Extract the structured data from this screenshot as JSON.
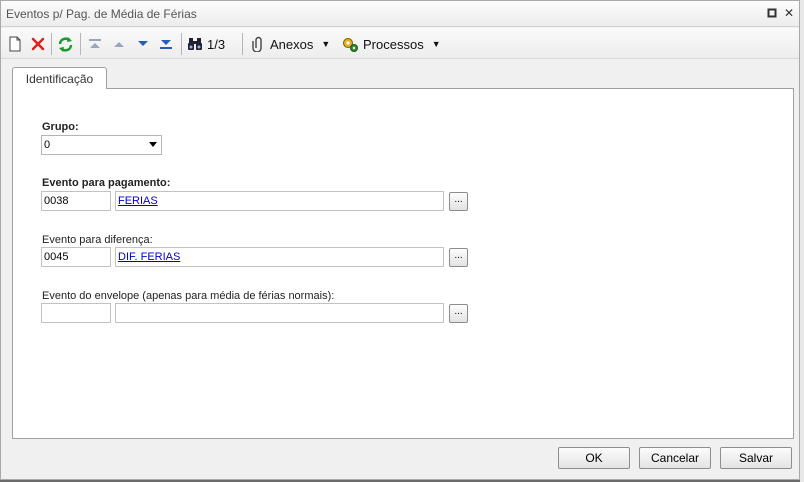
{
  "window": {
    "title": "Eventos p/ Pag. de Média de Férias",
    "restore_symbol": "▫",
    "close_symbol": "✕"
  },
  "toolbar": {
    "icons": [
      "new-icon",
      "delete-icon",
      "refresh-icon",
      "first-record-icon",
      "previous-record-icon",
      "next-record-icon",
      "last-record-icon",
      "search-icon"
    ],
    "record_position": "1/3",
    "attachments_label": "Anexos",
    "processes_label": "Processos"
  },
  "tabs": [
    {
      "label": "Identificação",
      "active": true
    }
  ],
  "form": {
    "grupo": {
      "label": "Grupo:",
      "value": "0"
    },
    "evento_pagamento": {
      "label": "Evento para pagamento:",
      "code": "0038",
      "description": "FERIAS"
    },
    "evento_diferenca": {
      "label": "Evento para diferença:",
      "code": "0045",
      "description": "DIF. FERIAS"
    },
    "evento_envelope": {
      "label": "Evento do envelope (apenas para média de férias normais):",
      "code": "",
      "description": ""
    },
    "lookup_button_label": "..."
  },
  "footer": {
    "ok_label": "OK",
    "cancel_label": "Cancelar",
    "save_label": "Salvar"
  },
  "colors": {
    "link": "#0000cc",
    "delete_red": "#e0201a",
    "refresh_green": "#1a9a2a",
    "nav_blue": "#2b5bb8"
  }
}
